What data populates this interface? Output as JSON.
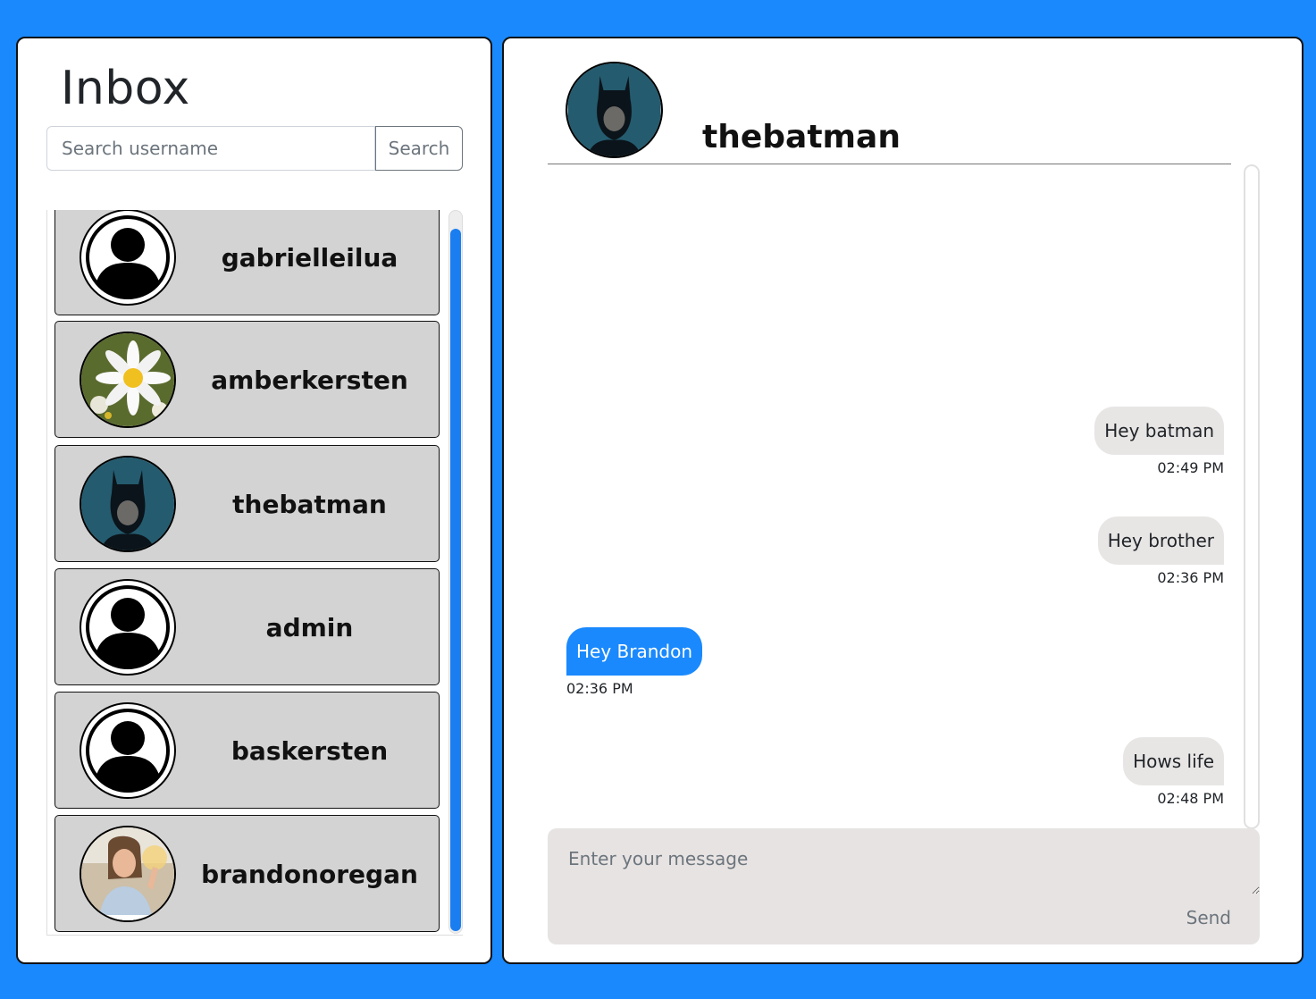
{
  "inbox": {
    "title": "Inbox",
    "search_placeholder": "Search username",
    "search_button": "Search",
    "users": [
      {
        "username": "gabrielleilua",
        "avatar": "default-user-icon"
      },
      {
        "username": "amberkersten",
        "avatar": "daisy-photo"
      },
      {
        "username": "thebatman",
        "avatar": "batman-photo"
      },
      {
        "username": "admin",
        "avatar": "default-user-icon"
      },
      {
        "username": "baskersten",
        "avatar": "default-user-icon"
      },
      {
        "username": "brandonoregan",
        "avatar": "woman-photo"
      }
    ]
  },
  "chat": {
    "username": "thebatman",
    "avatar": "batman-photo",
    "messages": [
      {
        "text": "Hey batman",
        "time": "02:49 PM",
        "side": "sent"
      },
      {
        "text": "Hey brother",
        "time": "02:36 PM",
        "side": "sent"
      },
      {
        "text": "Hey Brandon",
        "time": "02:36 PM",
        "side": "received"
      },
      {
        "text": "Hows life",
        "time": "02:48 PM",
        "side": "sent"
      }
    ],
    "compose_placeholder": "Enter your message",
    "send_button": "Send"
  },
  "colors": {
    "background": "#1a89fd",
    "card": "#d3d3d3",
    "received_bubble": "#1a89fd",
    "sent_bubble": "#e8e6e5",
    "compose_bg": "#e7e3e2",
    "scrollbar": "#1a7ef0"
  }
}
